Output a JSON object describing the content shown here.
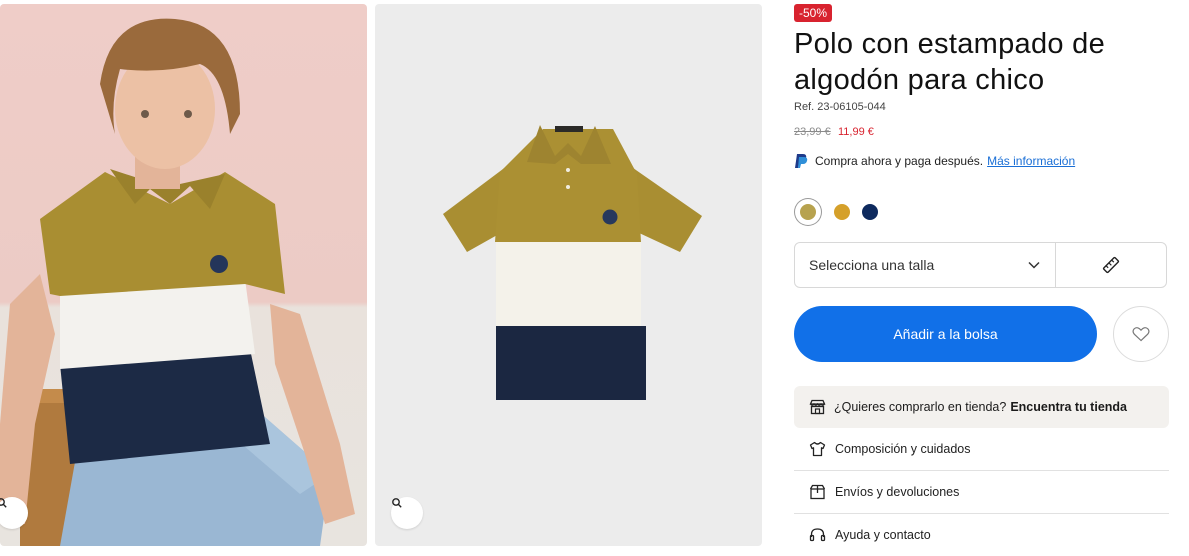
{
  "product": {
    "discount_badge": "-50%",
    "title": "Polo con estampado de algodón para chico",
    "reference": "Ref. 23-06105-044",
    "price_original": "23,99 €",
    "price_sale": "11,99 €",
    "paypal_text": "Compra ahora y paga después.",
    "paypal_link": "Más información"
  },
  "colors": {
    "swatches": [
      "#b7a24e",
      "#d5a02a",
      "#0e2a5e"
    ],
    "accent": "#1170e8",
    "sale": "#d8232f"
  },
  "size": {
    "placeholder": "Selecciona una talla",
    "guide_icon": "ruler-icon"
  },
  "actions": {
    "add_to_bag": "Añadir a la bolsa",
    "wishlist_icon": "heart-icon"
  },
  "store": {
    "question": "¿Quieres comprarlo en tienda?",
    "link": "Encuentra tu tienda"
  },
  "links": {
    "composition": "Composición y cuidados",
    "shipping": "Envíos y devoluciones",
    "help": "Ayuda y contacto"
  }
}
